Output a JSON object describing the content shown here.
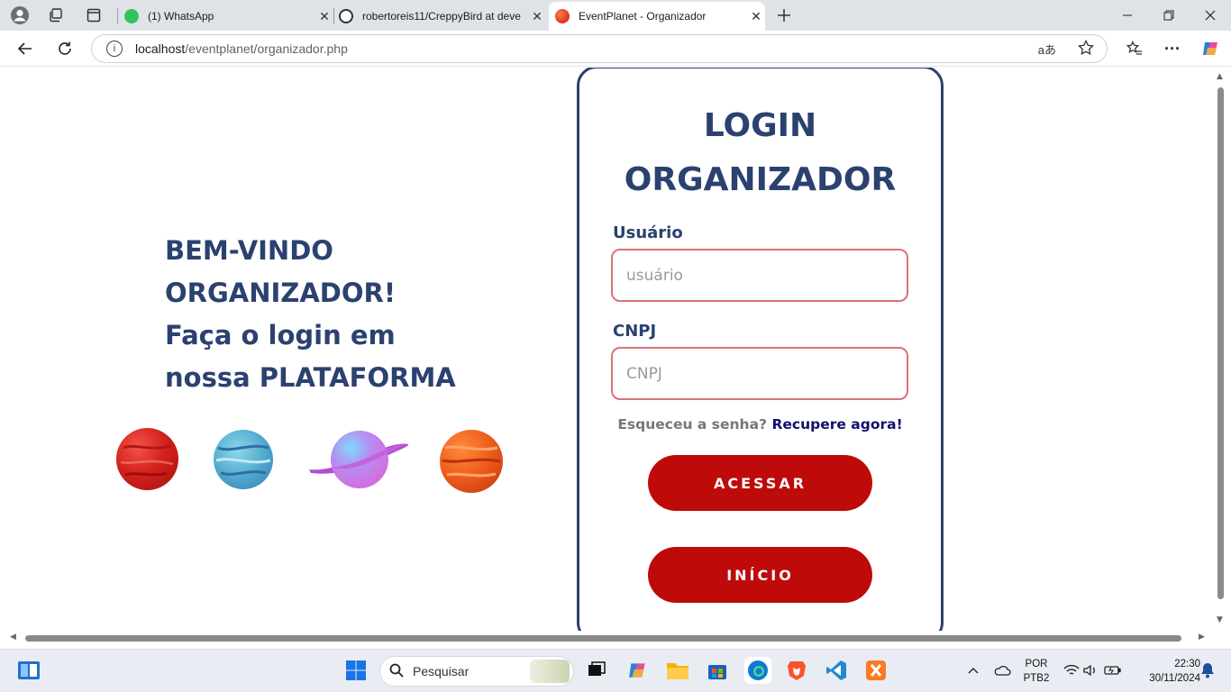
{
  "browser": {
    "tabs": [
      {
        "title": "(1) WhatsApp",
        "icon": "whatsapp-icon",
        "active": false
      },
      {
        "title": "robertoreis11/CreppyBird at deve",
        "icon": "github-icon",
        "active": false
      },
      {
        "title": "EventPlanet - Organizador",
        "icon": "planet-favicon",
        "active": true
      }
    ],
    "new_tab_icon": "plus-icon",
    "url_host": "localhost",
    "url_path": "/eventplanet/organizador.php",
    "window_controls": [
      "minimize-icon",
      "restore-icon",
      "close-icon"
    ]
  },
  "page": {
    "welcome_lines": [
      "BEM-VINDO",
      "ORGANIZADOR!",
      "Faça o login em",
      "nossa PLATAFORMA"
    ],
    "login_title_lines": [
      "LOGIN",
      "ORGANIZADOR"
    ],
    "user_label": "Usuário",
    "user_placeholder": "usuário",
    "cnpj_label": "CNPJ",
    "cnpj_placeholder": "CNPJ",
    "forgot_question": "Esqueceu a senha?",
    "forgot_link": "Recupere agora!",
    "access_button": "ACESSAR",
    "home_button": "INÍCIO",
    "colors": {
      "primary": "#2b4170",
      "button": "#bf0a0a",
      "field_border": "#d9727a",
      "link": "#11106a"
    }
  },
  "taskbar": {
    "search_placeholder": "Pesquisar",
    "language_line1": "POR",
    "language_line2": "PTB2",
    "time": "22:30",
    "date": "30/11/2024"
  }
}
